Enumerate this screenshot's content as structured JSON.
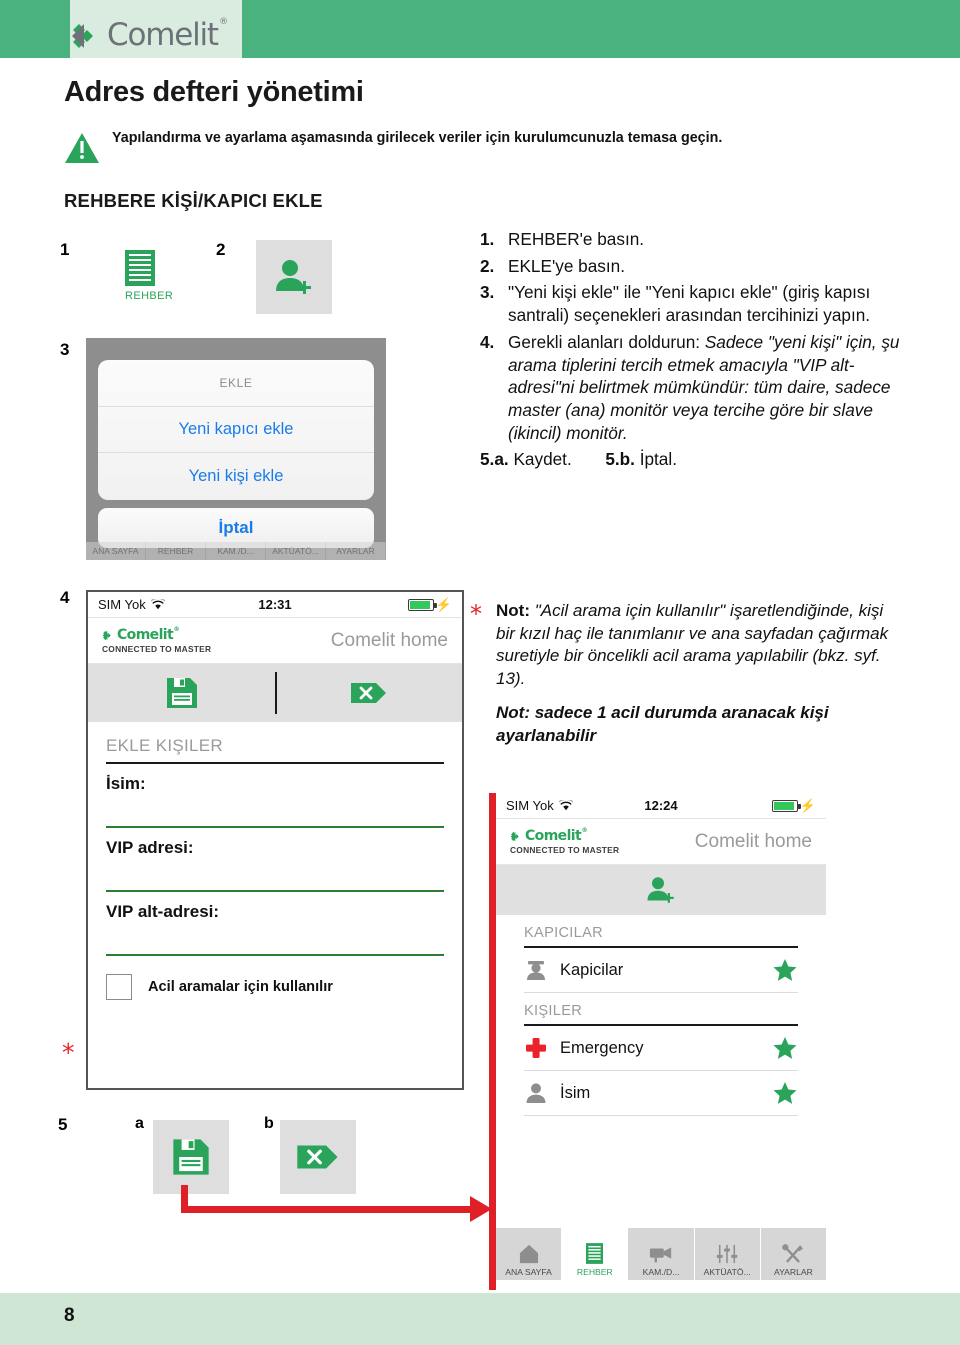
{
  "header": {
    "logo_word": "Comelit",
    "logo_reg": "®",
    "band_color": "#49b27e",
    "plate_color": "#d9ecdf"
  },
  "page_title": "Adres defteri yönetimi",
  "warning": {
    "icon": "warning-triangle-icon",
    "text": "Yapılandırma ve ayarlama aşamasında girilecek veriler için kurulumcunuzla temasa geçin."
  },
  "section_title": "REHBERE KİŞİ/KAPICI EKLE",
  "steps": {
    "n1": "1",
    "n2": "2",
    "n3": "3",
    "n4": "4",
    "n5": "5",
    "sub_a": "a",
    "sub_b": "b",
    "asterisk": "*"
  },
  "step1": {
    "icon": "directory-lines-icon",
    "caption": "REHBER"
  },
  "step2": {
    "icon": "add-person-icon"
  },
  "step3_dialog": {
    "title": "EKLE",
    "options": [
      "Yeni kapıcı ekle",
      "Yeni kişi ekle"
    ],
    "cancel": "İptal",
    "tabs": [
      "ANA SAYFA",
      "REHBER",
      "KAM./D...",
      "AKTÜATÖ...",
      "AYARLAR"
    ]
  },
  "instructions": [
    {
      "num": "1.",
      "text": "REHBER'e basın."
    },
    {
      "num": "2.",
      "text": "EKLE'ye basın."
    },
    {
      "num": "3.",
      "text": "\"Yeni kişi ekle\" ile \"Yeni kapıcı ekle\" (giriş kapısı santrali) seçenekleri arasından tercihinizi yapın."
    },
    {
      "num": "4.",
      "lead": "Gerekli alanları doldurun: ",
      "italic": "Sadece \"yeni kişi\" için, şu arama tiplerini tercih etmek amacıyla \"VIP alt-adresi\"ni belirtmek mümkündür: tüm daire, sadece master (ana) monitör veya tercihe göre bir slave (ikincil) monitör."
    }
  ],
  "instruction_five": {
    "a_num": "5.a.",
    "a_text": "Kaydet.",
    "b_num": "5.b.",
    "b_text": "İptal."
  },
  "note": {
    "star": "*",
    "label": "Not:",
    "body": " \"Acil arama için kullanılır\" işaretlendiğinde, kişi bir kızıl haç ile tanımlanır ve ana sayfadan çağırmak suretiyle bir öncelikli acil arama yapılabilir (bkz. syf. 13).",
    "second": "Not: sadece 1 acil durumda aranacak kişi ayarlanabilir"
  },
  "shot4": {
    "status": {
      "carrier": "SIM Yok",
      "wifi_icon": "wifi-icon",
      "time": "12:31",
      "battery_icon": "battery-icon",
      "charge_icon": "bolt-icon"
    },
    "appbar": {
      "logo": "Comelit",
      "logo_reg": "®",
      "subtitle": "CONNECTED TO MASTER",
      "right_title": "Comelit home"
    },
    "toolbar": {
      "save_icon": "floppy-save-icon",
      "cancel_icon": "x-tag-cancel-icon"
    },
    "form_head": "EKLE KIŞILER",
    "fields": [
      {
        "label": "İsim:",
        "value": ""
      },
      {
        "label": "VIP adresi:",
        "value": ""
      },
      {
        "label": "VIP alt-adresi:",
        "value": ""
      }
    ],
    "checkbox": {
      "label": "Acil aramalar için kullanılır",
      "checked": false
    }
  },
  "step5": {
    "a_icon": "floppy-save-icon",
    "b_icon": "x-tag-cancel-icon"
  },
  "shot6": {
    "status": {
      "carrier": "SIM Yok",
      "wifi_icon": "wifi-icon",
      "time": "12:24",
      "battery_icon": "battery-icon",
      "charge_icon": "bolt-icon"
    },
    "appbar": {
      "logo": "Comelit",
      "logo_reg": "®",
      "subtitle": "CONNECTED TO MASTER",
      "right_title": "Comelit home"
    },
    "toolbar": {
      "add_icon": "add-person-icon"
    },
    "sections": [
      {
        "header": "KAPICILAR",
        "rows": [
          {
            "icon": "concierge-icon",
            "name": "Kapicilar",
            "star": "★"
          }
        ]
      },
      {
        "header": "KIŞILER",
        "rows": [
          {
            "icon": "red-cross-icon",
            "name": "Emergency",
            "star": "★"
          },
          {
            "icon": "person-icon",
            "name": "İsim",
            "star": "★"
          }
        ]
      }
    ],
    "tabs": [
      {
        "label": "ANA SAYFA",
        "icon": "home-icon",
        "selected": false
      },
      {
        "label": "REHBER",
        "icon": "directory-lines-icon",
        "selected": true
      },
      {
        "label": "KAM./D...",
        "icon": "camera-icon",
        "selected": false
      },
      {
        "label": "AKTÜATÖ...",
        "icon": "sliders-icon",
        "selected": false
      },
      {
        "label": "AYARLAR",
        "icon": "tools-icon",
        "selected": false
      }
    ]
  },
  "footer": {
    "page_number": "8",
    "color": "#cfe6d4"
  },
  "colors": {
    "green": "#2aa45a",
    "brand_green": "#49b27e",
    "red": "#e02027",
    "blue": "#1a7ce8"
  }
}
